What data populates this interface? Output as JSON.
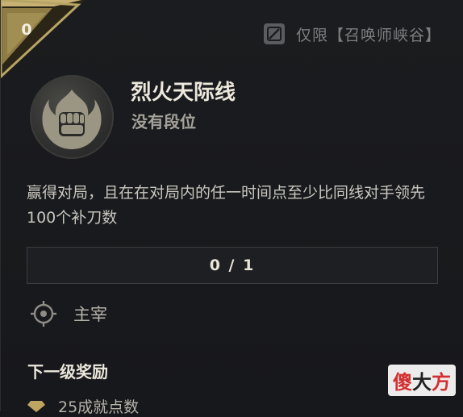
{
  "badge": {
    "level": "0"
  },
  "queue": {
    "label": "仅限【召唤师峡谷】",
    "icon": "no-entry-icon"
  },
  "challenge": {
    "title": "烈火天际线",
    "rank": "没有段位",
    "description": "赢得对局，且在在对局内的任一时间点至少比同线对手领先100个补刀数",
    "emblem_icon": "fist-flame-icon"
  },
  "progress": {
    "text": "0 / 1",
    "fraction": 0
  },
  "role": {
    "label": "主宰",
    "icon": "target-icon"
  },
  "reward": {
    "heading": "下一级奖励",
    "item": "25成就点数",
    "icon": "gem-icon"
  },
  "watermark": {
    "chars": [
      "傻",
      "大",
      "方"
    ]
  },
  "colors": {
    "background": "#17181b",
    "gold": "#b8a464",
    "text_primary": "#ece8dc",
    "text_secondary": "#a4a29b",
    "watermark_1": "#d32f2f",
    "watermark_2": "#1f1f1f",
    "watermark_3": "#d32f2f"
  }
}
